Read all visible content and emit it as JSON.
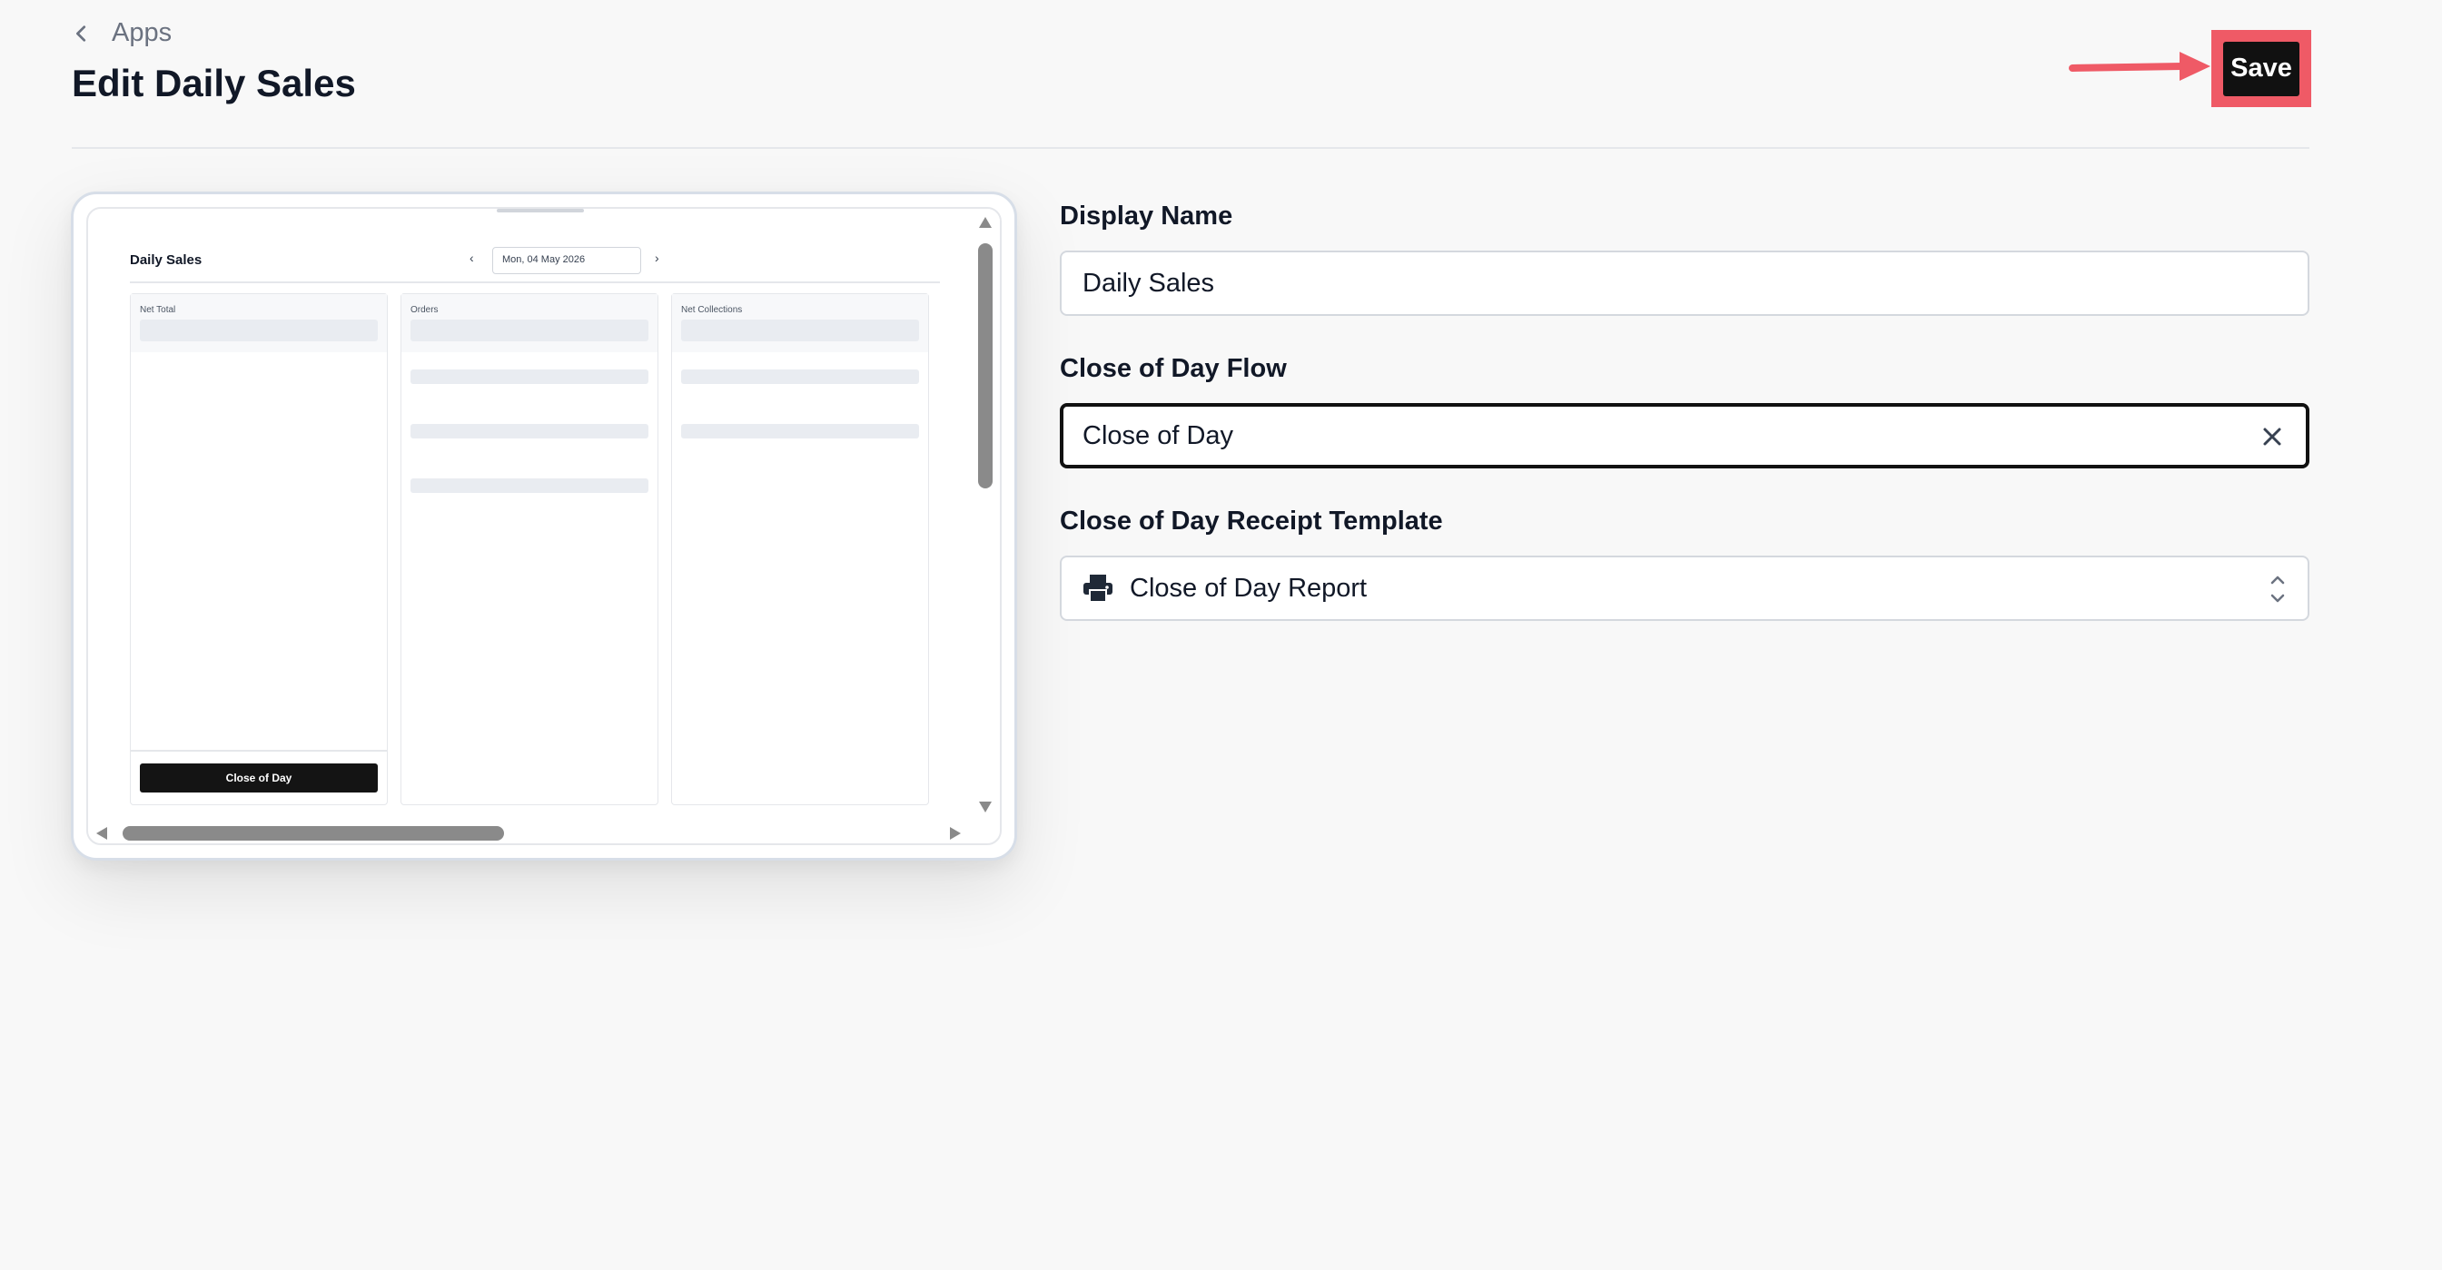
{
  "header": {
    "back_label": "Apps",
    "title": "Edit Daily Sales",
    "save_label": "Save"
  },
  "annotation": {
    "arrow_color": "#ef5a66"
  },
  "preview": {
    "title": "Daily Sales",
    "date": "Mon, 04 May 2026",
    "columns": [
      "Net Total",
      "Orders",
      "Net Collections"
    ],
    "close_button": "Close of Day"
  },
  "form": {
    "display_name": {
      "label": "Display Name",
      "value": "Daily Sales"
    },
    "flow": {
      "label": "Close of Day Flow",
      "value": "Close of Day"
    },
    "receipt_template": {
      "label": "Close of Day Receipt Template",
      "value": "Close of Day Report"
    }
  },
  "icons": [
    "chevron-left-icon",
    "close-icon",
    "printer-icon",
    "chevron-up-down-icon"
  ]
}
